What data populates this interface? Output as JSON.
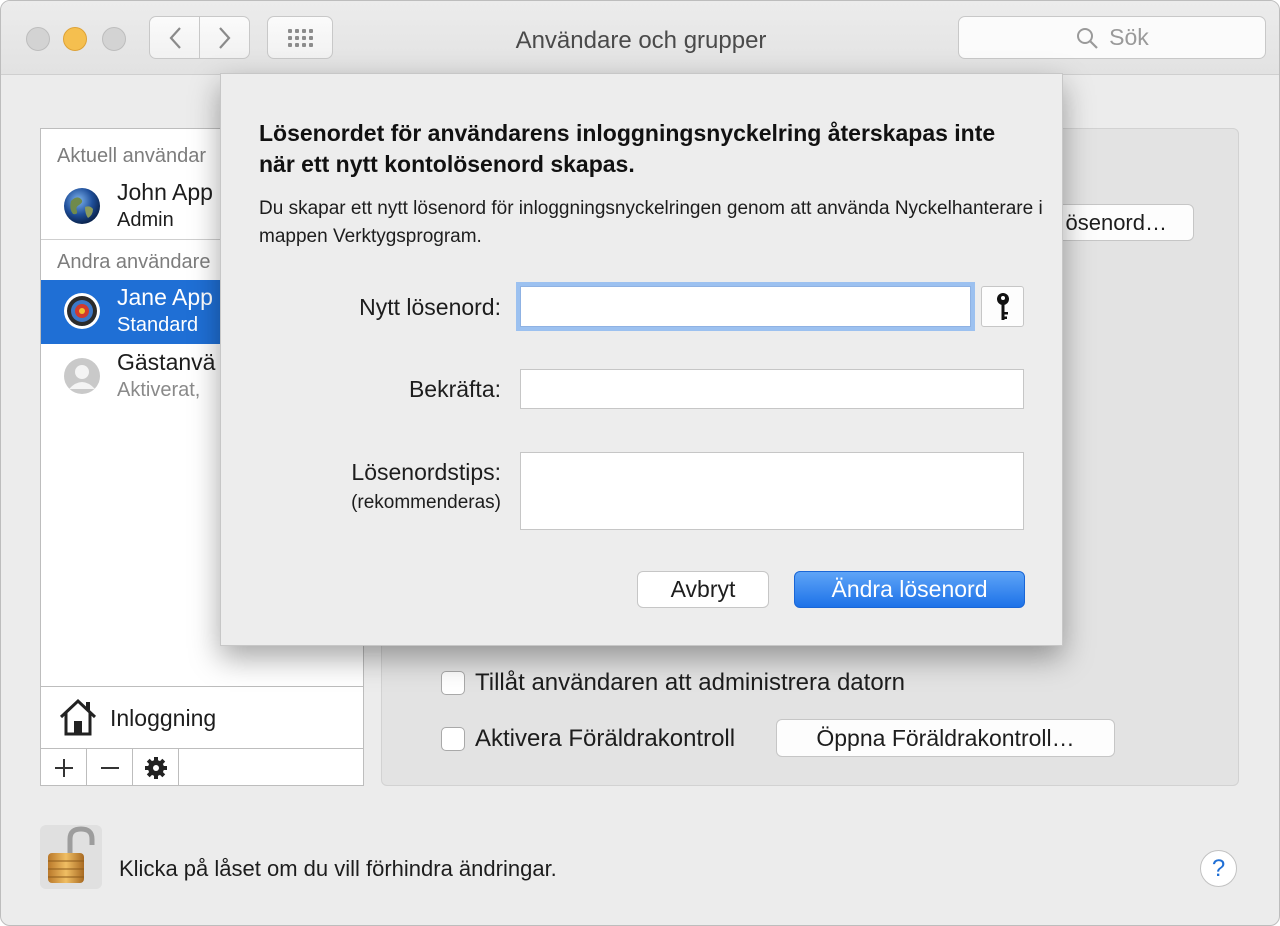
{
  "window": {
    "title": "Användare och grupper",
    "search_placeholder": "Sök"
  },
  "sidebar": {
    "current_users_header": "Aktuell användar",
    "current_user": {
      "name": "John App",
      "role": "Admin"
    },
    "other_users_header": "Andra användare",
    "other_users": [
      {
        "name": "Jane App",
        "role": "Standard",
        "selected": true
      },
      {
        "name": "Gästanvä",
        "role": "Aktiverat,",
        "selected": false
      }
    ],
    "login_options_label": "Inloggning",
    "bottom_buttons": [
      "+",
      "—",
      "gear"
    ]
  },
  "panel": {
    "change_password_button": "ösenord…",
    "allow_admin_label": "Tillåt användaren att administrera datorn",
    "parental_controls_label": "Aktivera Föräldrakontroll",
    "open_parental_button": "Öppna Föräldrakontroll…"
  },
  "footer": {
    "lock_text": "Klicka på låset om du vill förhindra ändringar.",
    "help": "?"
  },
  "sheet": {
    "title": "Lösenordet för användarens inloggningsnyckelring återskapas inte när ett nytt kontolösenord skapas.",
    "description": "Du skapar ett nytt lösenord för inloggningsnyckelringen genom att använda Nyckelhanterare i mappen Verktygsprogram.",
    "new_password_label": "Nytt lösenord:",
    "new_password_value": "",
    "confirm_label": "Bekräfta:",
    "confirm_value": "",
    "hint_label": "Lösenordstips:",
    "hint_sub_label": "(rekommenderas)",
    "hint_value": "",
    "cancel_button": "Avbryt",
    "change_button": "Ändra lösenord"
  },
  "colors": {
    "accent": "#1f6fd5",
    "primary_button": "#1d72e8",
    "minimize": "#f5bf4f"
  }
}
